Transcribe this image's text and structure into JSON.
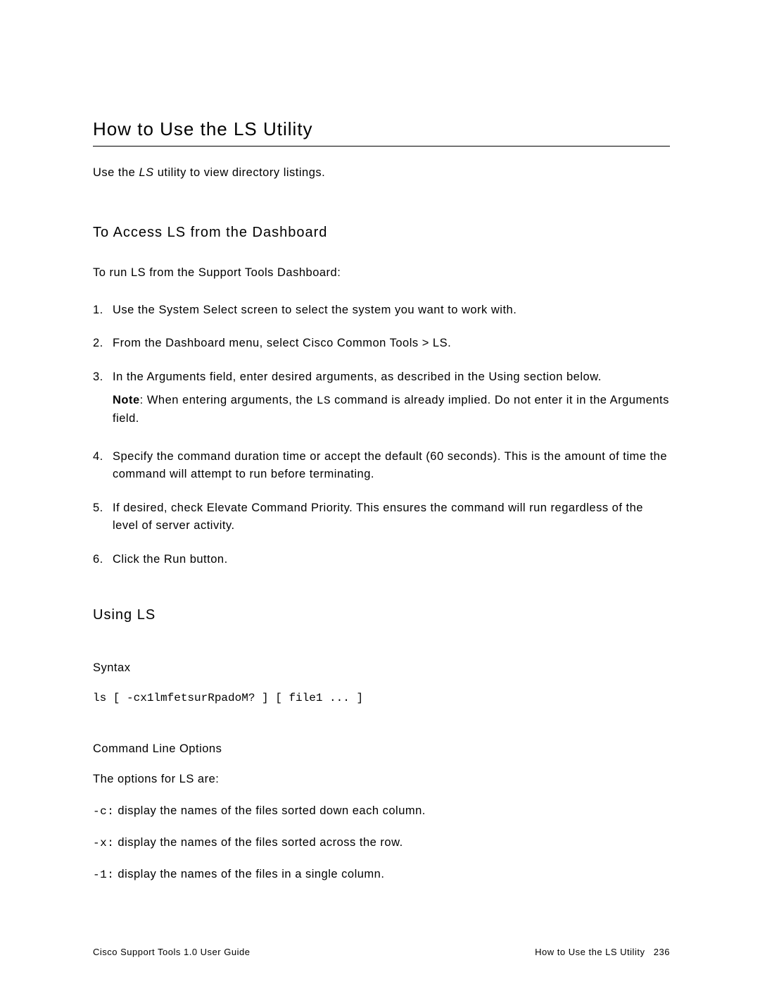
{
  "title": "How to Use the LS Utility",
  "intro_pre": "Use the ",
  "intro_italic": "LS",
  "intro_post": " utility to view directory listings.",
  "section1": {
    "heading": "To Access LS from the Dashboard",
    "lead": "To run LS from the Support Tools Dashboard:",
    "items": [
      {
        "num": "1.",
        "text": "Use the System Select screen to select the system you want to work with."
      },
      {
        "num": "2.",
        "text": "From the Dashboard menu, select Cisco Common Tools > LS."
      },
      {
        "num": "3.",
        "text": "In the Arguments field, enter desired arguments, as described in the Using section below."
      },
      {
        "num": "4.",
        "text": "Specify the command duration time or accept the default (60 seconds). This is the amount of time the command will attempt to run before terminating."
      },
      {
        "num": "5.",
        "text": "If desired, check Elevate Command Priority. This ensures the command will run regardless of the level of server activity."
      },
      {
        "num": "6.",
        "text": "Click the Run button."
      }
    ],
    "note_label": "Note",
    "note_pre": ": When entering arguments, the ",
    "note_code": "LS",
    "note_post": " command is already implied. Do not enter it in the Arguments field."
  },
  "section2": {
    "heading": "Using LS",
    "syntax_heading": "Syntax",
    "syntax_code": "ls [ -cx1lmfetsurRpadoM? ] [ file1 ... ]",
    "options_heading": "Command Line Options",
    "options_intro": "The options for LS are:",
    "options": [
      {
        "flag": "-c:",
        "desc": " display the names of the files sorted down each column."
      },
      {
        "flag": "-x:",
        "desc": " display the names of the files sorted across the row."
      },
      {
        "flag": "-1:",
        "desc": " display the names of the files in a single column."
      }
    ]
  },
  "footer": {
    "left": "Cisco Support Tools 1.0 User Guide",
    "right_text": "How to Use the LS Utility",
    "right_page": "236"
  }
}
